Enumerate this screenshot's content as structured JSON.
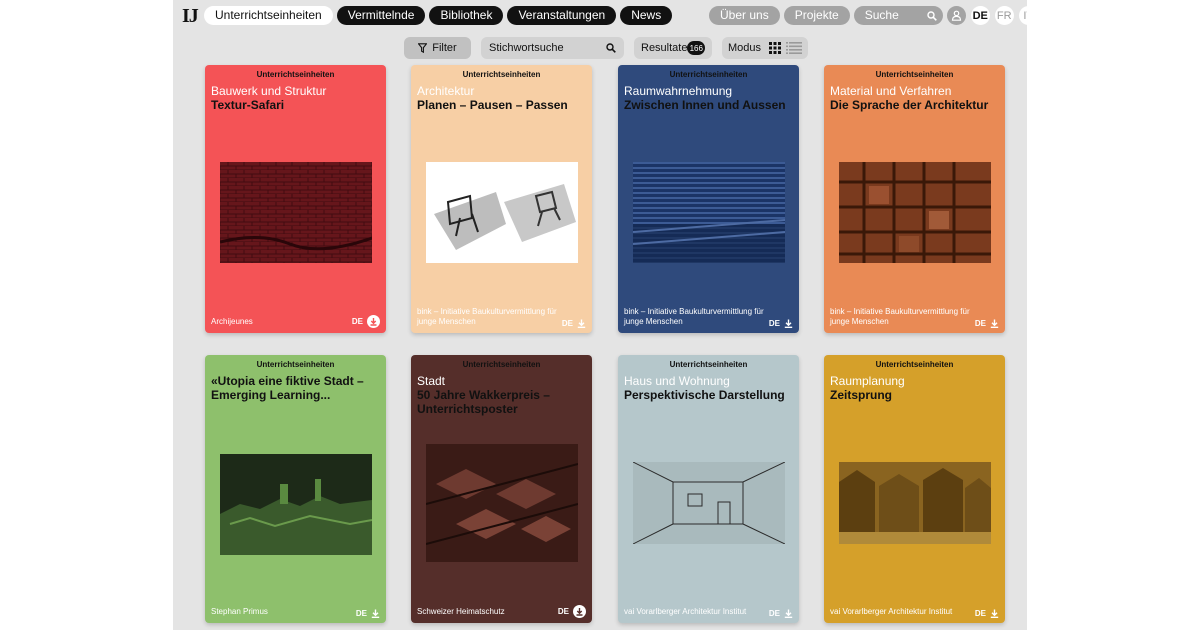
{
  "logo": "IJ",
  "nav": {
    "left": [
      "Unterrichtseinheiten",
      "Vermittelnde",
      "Bibliothek",
      "Veranstaltungen",
      "News"
    ],
    "right": [
      "Über uns",
      "Projekte"
    ],
    "search_label": "Suche",
    "languages": [
      "DE",
      "FR",
      "IT"
    ]
  },
  "toolbar": {
    "filter_label": "Filter",
    "keyword_placeholder": "Stichwortsuche",
    "results_label": "Resultate",
    "results_count": "166",
    "mode_label": "Modus"
  },
  "cards": [
    {
      "type": "Unterrichtseinheiten",
      "category": "Bauwerk und Struktur",
      "title": "Textur-Safari",
      "publisher": "Archijeunes",
      "lang": "DE",
      "bg": "#f45356",
      "cat_color": "#ffffff",
      "pub_color": "#ffffff",
      "icon": "download-circle-icon"
    },
    {
      "type": "Unterrichtseinheiten",
      "category": "Architektur",
      "title": "Planen – Pausen – Passen",
      "publisher": "bink – Initiative Baukulturvermittlung für junge Menschen",
      "lang": "DE",
      "bg": "#f7cfa5",
      "cat_color": "#ffffff",
      "pub_color": "#ffffff",
      "icon": "download-icon"
    },
    {
      "type": "Unterrichtseinheiten",
      "category": "Raumwahrnehmung",
      "title": "Zwischen Innen und Aussen",
      "publisher": "bink – Initiative Baukulturvermittlung für junge Menschen",
      "lang": "DE",
      "bg": "#2f4a7c",
      "cat_color": "#ffffff",
      "pub_color": "#ffffff",
      "icon": "download-icon"
    },
    {
      "type": "Unterrichtseinheiten",
      "category": "Material und Verfahren",
      "title": "Die Sprache der Architektur",
      "publisher": "bink – Initiative Baukulturvermittlung für junge Menschen",
      "lang": "DE",
      "bg": "#e98a55",
      "cat_color": "#ffffff",
      "pub_color": "#ffffff",
      "icon": "download-icon"
    },
    {
      "type": "Unterrichtseinheiten",
      "category": "",
      "title": "«Utopia eine fiktive Stadt – Emerging Learning...",
      "publisher": "Stephan Primus",
      "lang": "DE",
      "bg": "#8ec06c",
      "cat_color": "#ffffff",
      "pub_color": "#ffffff",
      "icon": "download-icon"
    },
    {
      "type": "Unterrichtseinheiten",
      "category": "Stadt",
      "title": "50 Jahre Wakkerpreis – Unterrichtsposter",
      "publisher": "Schweizer Heimatschutz",
      "lang": "DE",
      "bg": "#552e2a",
      "cat_color": "#ffffff",
      "pub_color": "#ffffff",
      "icon": "download-circle-icon"
    },
    {
      "type": "Unterrichtseinheiten",
      "category": "Haus und Wohnung",
      "title": "Perspektivische Darstellung",
      "publisher": "vai Vorarlberger Architektur Institut",
      "lang": "DE",
      "bg": "#b5c7cb",
      "cat_color": "#ffffff",
      "pub_color": "#ffffff",
      "icon": "download-icon"
    },
    {
      "type": "Unterrichtseinheiten",
      "category": "Raumplanung",
      "title": "Zeitsprung",
      "publisher": "vai Vorarlberger Architektur Institut",
      "lang": "DE",
      "bg": "#d5a02a",
      "cat_color": "#ffffff",
      "pub_color": "#ffffff",
      "icon": "download-icon"
    }
  ]
}
